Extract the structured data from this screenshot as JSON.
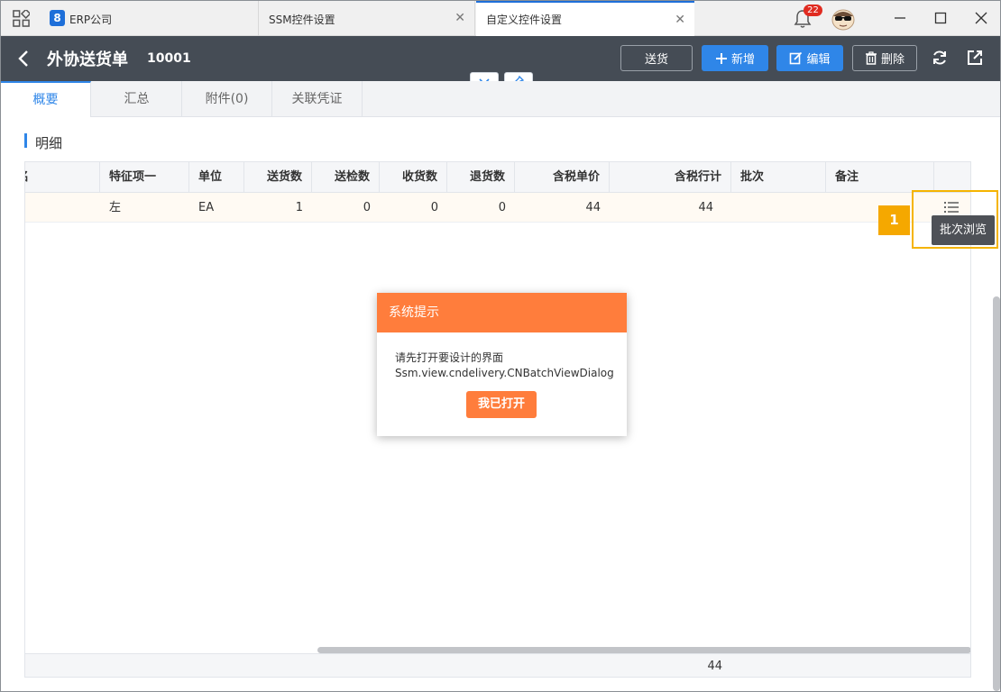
{
  "window": {
    "tabs": [
      {
        "label": "ERP公司",
        "logo": "8"
      },
      {
        "label": "SSM控件设置",
        "close": "✕"
      },
      {
        "label": "自定义控件设置",
        "close": "✕"
      }
    ],
    "notification_count": "22",
    "icons": [
      "apps-grid-icon",
      "bell-icon",
      "avatar",
      "minimize-icon",
      "maximize-icon",
      "close-icon"
    ]
  },
  "header": {
    "title": "外协送货单",
    "doc_number": "10001",
    "buttons": {
      "send": "送货",
      "add": "新增",
      "edit": "编辑",
      "delete": "删除"
    },
    "icons": [
      "back-icon",
      "plus-icon",
      "edit-icon",
      "trash-icon",
      "refresh-icon",
      "export-icon",
      "chevron-down-icon",
      "pin-icon"
    ]
  },
  "subtabs": [
    {
      "label": "概要",
      "active": true
    },
    {
      "label": "汇总"
    },
    {
      "label": "附件(0)"
    },
    {
      "label": "关联凭证"
    }
  ],
  "section": {
    "title": "明细"
  },
  "grid": {
    "columns": [
      "名",
      "特征项一",
      "单位",
      "送货数",
      "送检数",
      "收货数",
      "退货数",
      "含税单价",
      "含税行计",
      "批次",
      "备注"
    ],
    "rows": [
      {
        "cells": [
          "",
          "左",
          "EA",
          "1",
          "0",
          "0",
          "0",
          "44",
          "44",
          "",
          ""
        ]
      }
    ],
    "footer_sum": "44"
  },
  "batch_browse": {
    "step": "1",
    "tooltip": "批次浏览"
  },
  "dialog": {
    "title": "系统提示",
    "message_line1": "请先打开要设计的界面",
    "message_line2": "Ssm.view.cndelivery.CNBatchViewDialog",
    "confirm": "我已打开"
  },
  "colors": {
    "header_bg": "#454c55",
    "primary": "#2f86e8",
    "dialog_orange": "#ff7d3c",
    "highlight": "#f5b400"
  }
}
